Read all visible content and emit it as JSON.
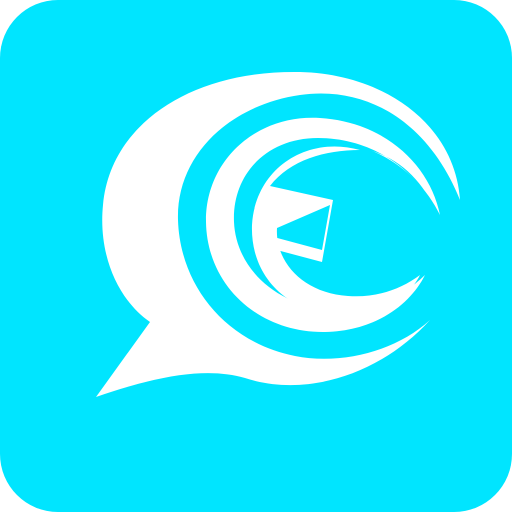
{
  "app_icon": {
    "icon_name": "chat-bubble-swirl-logo-icon",
    "colors": {
      "background": "#00E5FF",
      "foreground": "#FFFFFF"
    }
  }
}
